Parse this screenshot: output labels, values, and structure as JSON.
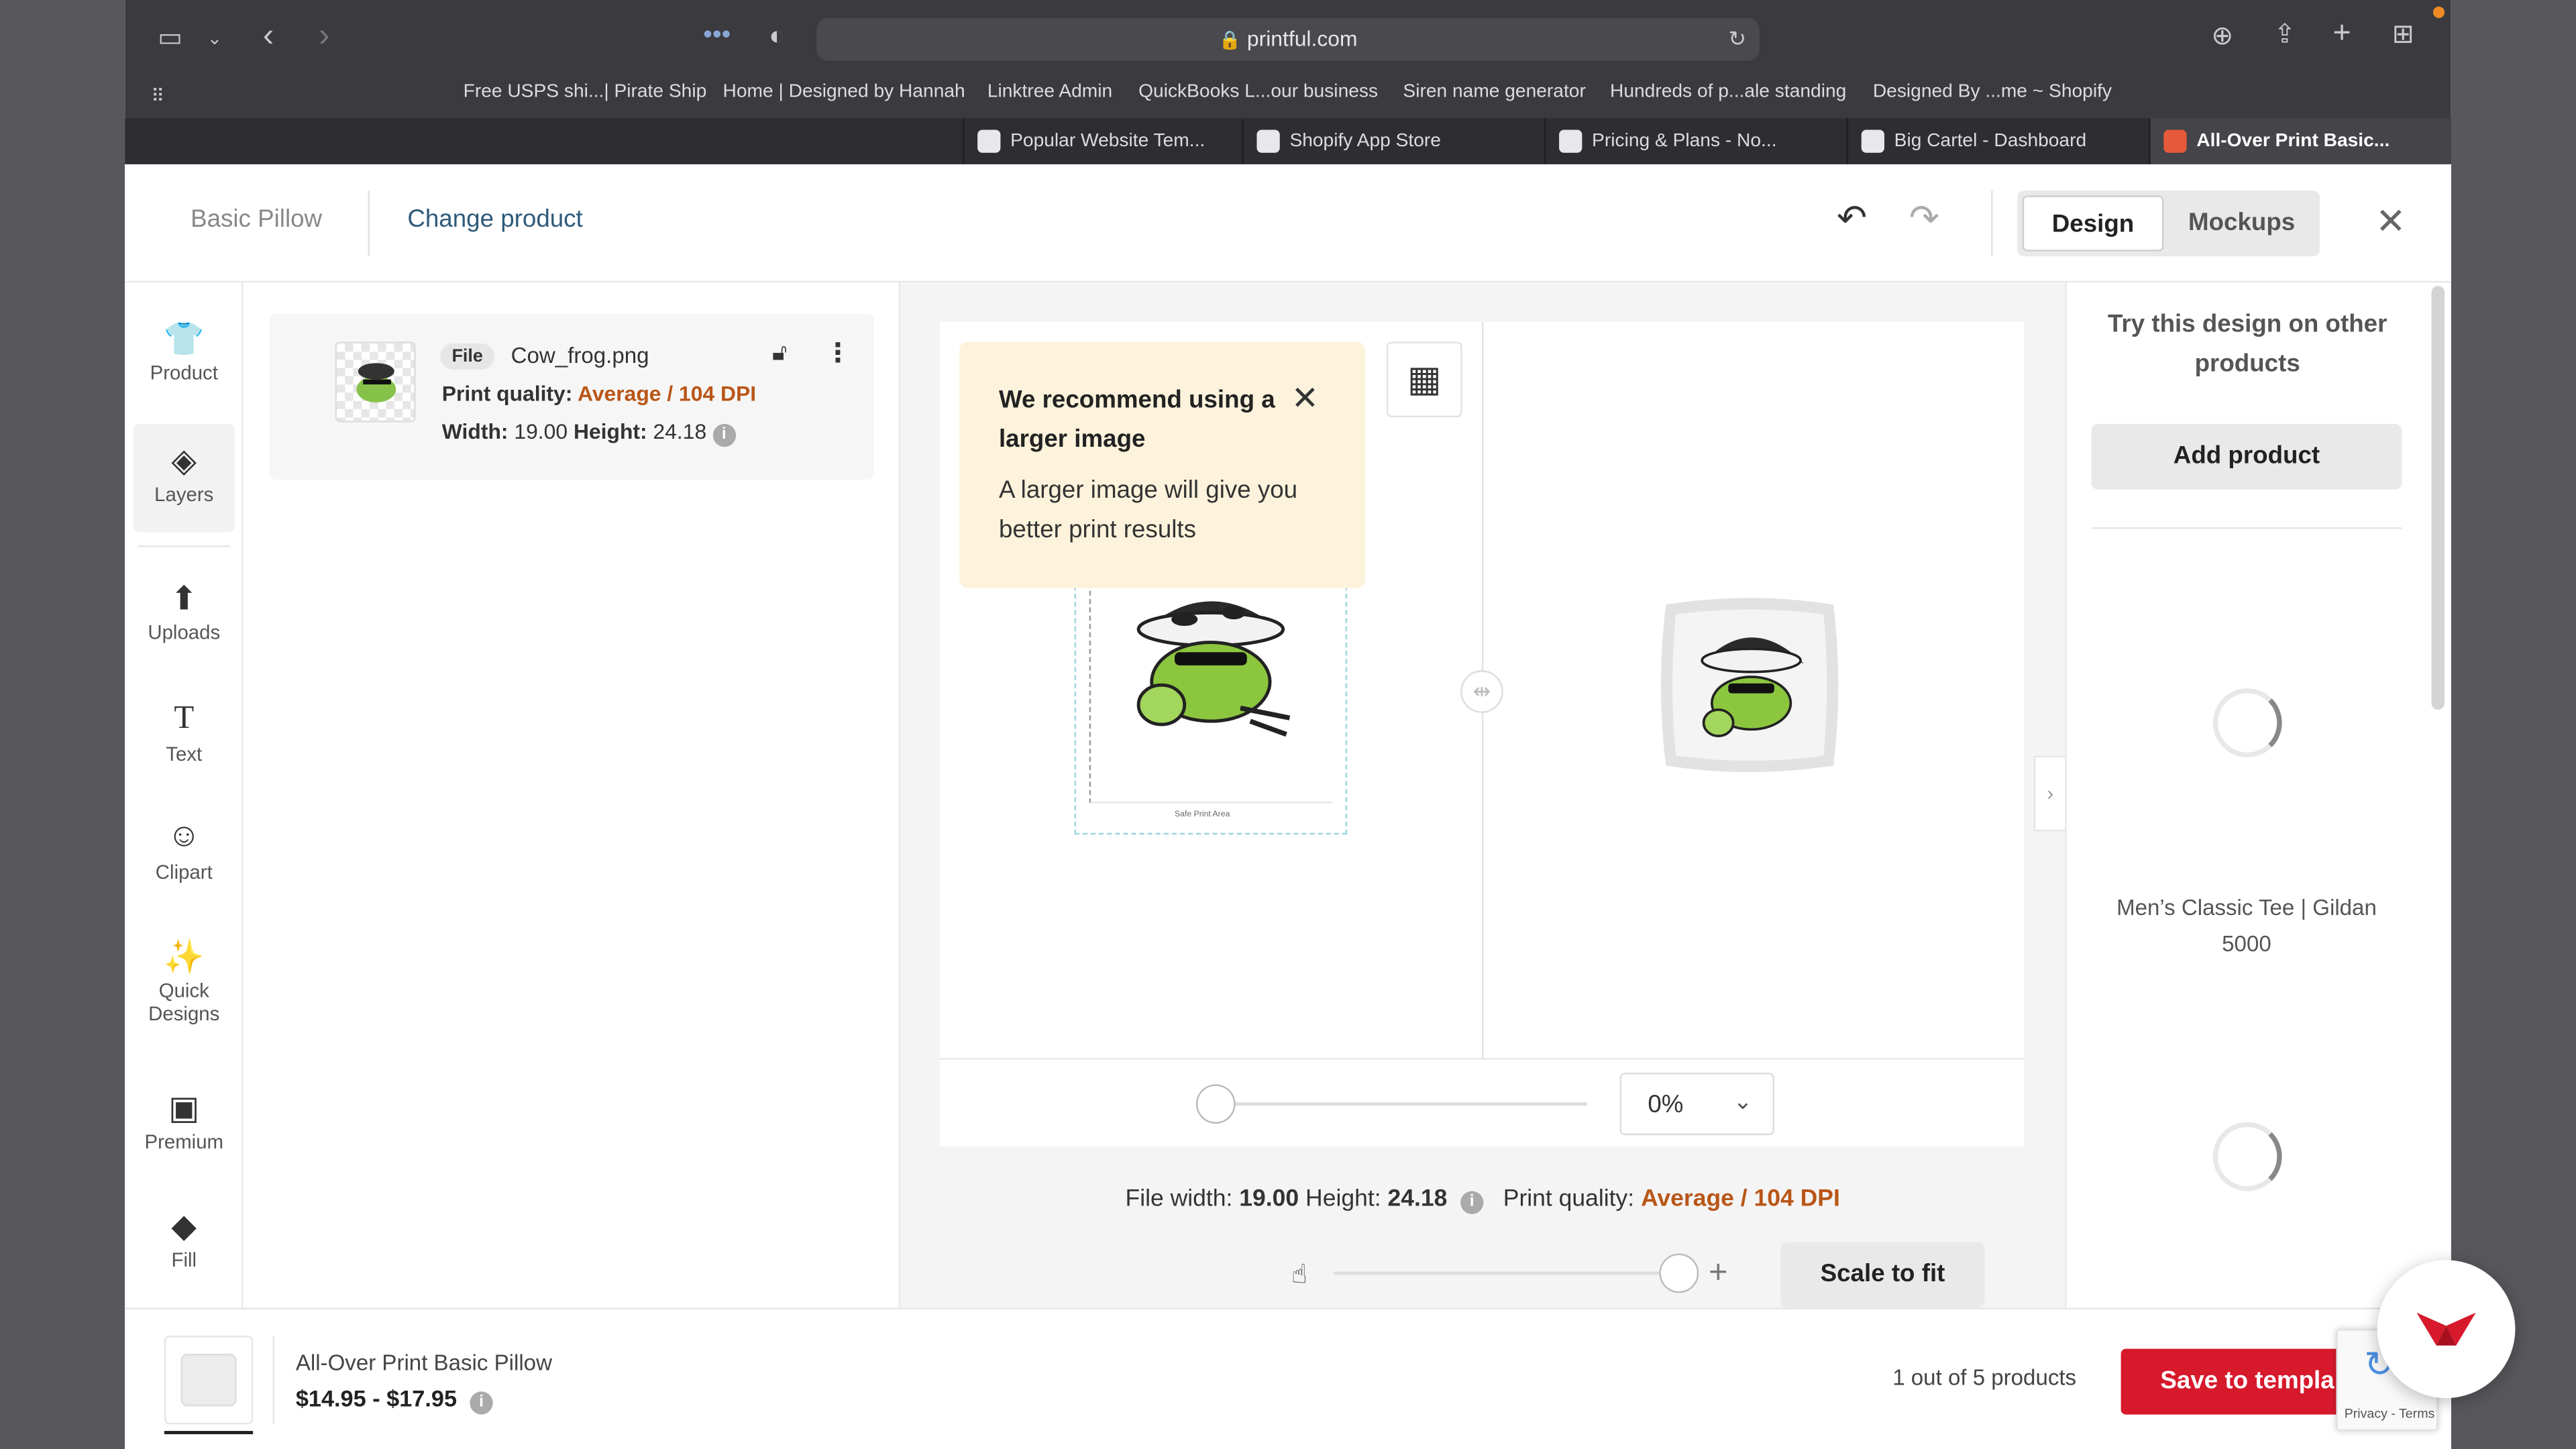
{
  "browser": {
    "url": "printful.com",
    "bookmarks": [
      "Free USPS shi...| Pirate Ship",
      "Home | Designed by Hannah",
      "Linktree Admin",
      "QuickBooks L...our business",
      "Siren name generator",
      "Hundreds of p...ale standing",
      "Designed By ...me ~ Shopify"
    ],
    "tabs": [
      "Popular Website Tem...",
      "Shopify App Store",
      "Pricing & Plans - No...",
      "Big Cartel - Dashboard",
      "All-Over Print Basic..."
    ]
  },
  "header": {
    "product_name": "Basic Pillow",
    "change_product": "Change product",
    "design_tab": "Design",
    "mockups_tab": "Mockups"
  },
  "sidebar": {
    "items": [
      {
        "label": "Product"
      },
      {
        "label": "Layers"
      },
      {
        "label": "Uploads"
      },
      {
        "label": "Text"
      },
      {
        "label": "Clipart"
      },
      {
        "label": "Quick Designs"
      },
      {
        "label": "Premium"
      },
      {
        "label": "Fill"
      }
    ]
  },
  "layer": {
    "badge": "File",
    "filename": "Cow_frog.png",
    "quality_label": "Print quality:",
    "quality_value": "Average / 104 DPI",
    "width_label": "Width:",
    "width_value": "19.00",
    "height_label": "Height:",
    "height_value": "24.18"
  },
  "tooltip": {
    "title": "We recommend using a larger image",
    "body": "A larger image will give you better print results"
  },
  "canvas": {
    "safe_area_label": "Safe Print Area",
    "zoom_value": "0%",
    "zoom_fraction": 0
  },
  "fileinfo": {
    "file_width_label": "File width:",
    "width": "19.00",
    "height_label": "Height:",
    "height": "24.18",
    "quality_label": "Print quality:",
    "quality": "Average / 104 DPI",
    "scale_button": "Scale to fit",
    "scale_fraction": 1
  },
  "right_panel": {
    "title": "Try this design on other products",
    "add_button": "Add product",
    "product_name": "Men’s Classic Tee | Gildan 5000"
  },
  "footer": {
    "product_name": "All-Over Print Basic Pillow",
    "price": "$14.95 - $17.95",
    "count": "1 out of 5 products",
    "save_button": "Save to templa",
    "recaptcha": "Privacy - Terms"
  },
  "colors": {
    "accent_red": "#d7192c",
    "warning_orange": "#b95617",
    "tooltip_bg": "#fdf3dc",
    "link_blue": "#2e5a7a"
  }
}
